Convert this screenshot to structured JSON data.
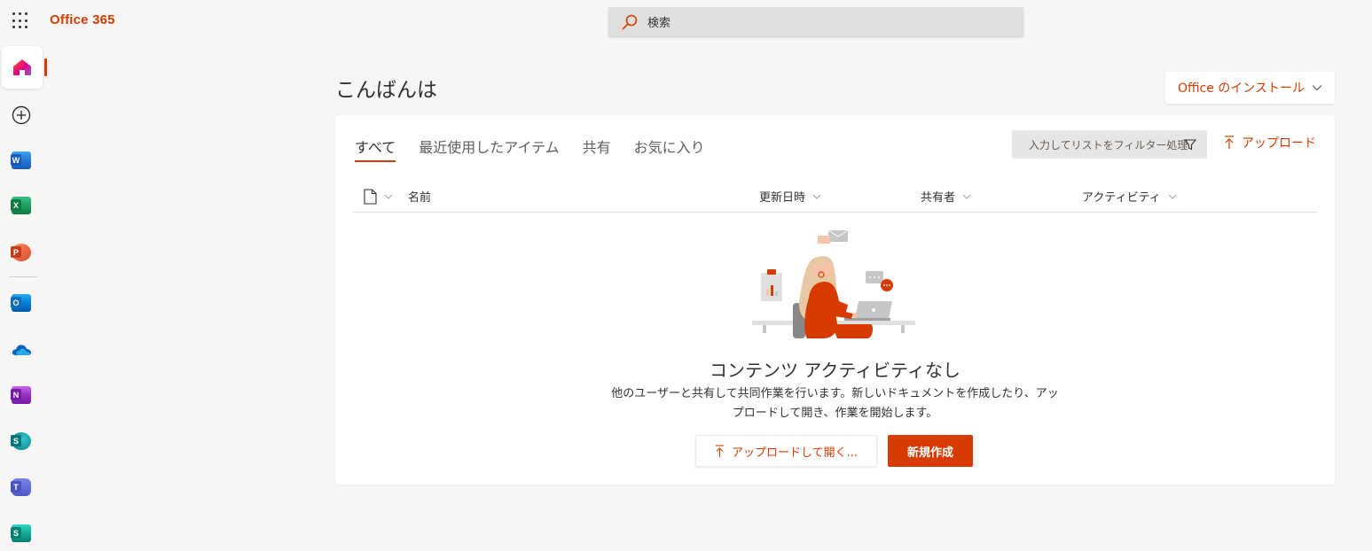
{
  "header": {
    "brand": "Office 365",
    "search_placeholder": "検索"
  },
  "rail": {
    "items": [
      {
        "name": "home-icon"
      },
      {
        "name": "create-icon"
      },
      {
        "name": "word-icon",
        "letter": "W",
        "color": "#185abd"
      },
      {
        "name": "excel-icon",
        "letter": "X",
        "color": "#107c41"
      },
      {
        "name": "powerpoint-icon",
        "letter": "P",
        "color": "#c43e1c"
      },
      {
        "name": "outlook-icon",
        "letter": "O",
        "color": "#0f6cbd"
      },
      {
        "name": "onedrive-icon"
      },
      {
        "name": "onenote-icon",
        "letter": "N",
        "color": "#7719aa"
      },
      {
        "name": "sharepoint-icon",
        "letter": "S",
        "color": "#03787c"
      },
      {
        "name": "teams-icon",
        "letter": "T",
        "color": "#4b53bc"
      },
      {
        "name": "sway-icon",
        "letter": "S",
        "color": "#008272"
      }
    ]
  },
  "main": {
    "greeting": "こんばんは",
    "install_label": "Office のインストール",
    "tabs": [
      {
        "label": "すべて",
        "active": true
      },
      {
        "label": "最近使用したアイテム"
      },
      {
        "label": "共有"
      },
      {
        "label": "お気に入り"
      }
    ],
    "filter_placeholder": "入力してリストをフィルター処理",
    "upload_label": "アップロード",
    "columns": {
      "name": "名前",
      "modified": "更新日時",
      "shared_by": "共有者",
      "activity": "アクティビティ"
    },
    "empty": {
      "title": "コンテンツ アクティビティなし",
      "description_line1": "他のユーザーと共有して共同作業を行います。新しいドキュメントを作成したり、アッ",
      "description_line2": "プロードして開き、作業を開始します。",
      "upload_open_label": "アップロードして開く...",
      "new_label": "新規作成"
    }
  },
  "colors": {
    "accent": "#d83b01",
    "background": "#f8f6f4"
  }
}
